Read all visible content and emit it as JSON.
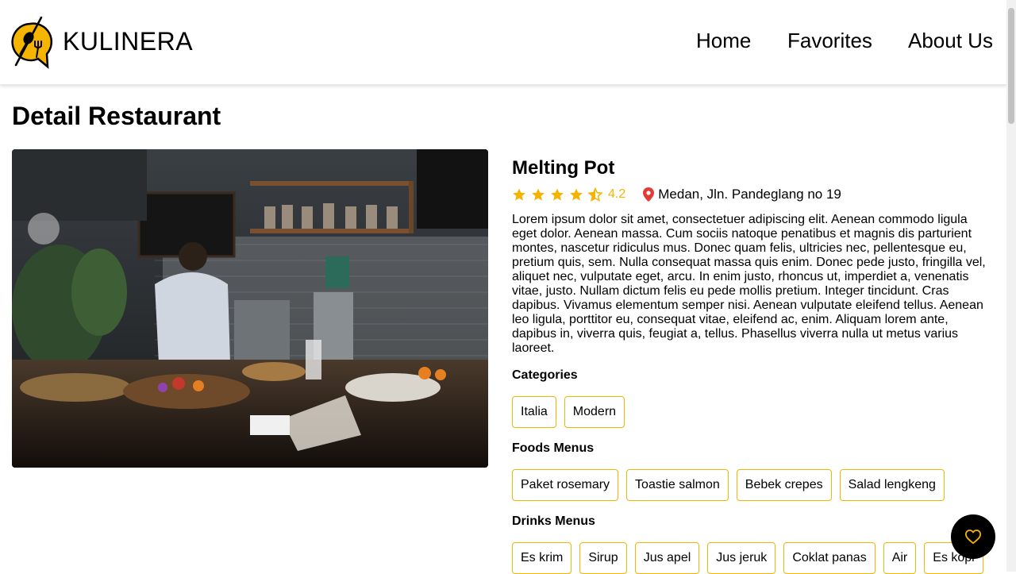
{
  "header": {
    "brand": "KULINERA",
    "nav": {
      "home": "Home",
      "favorites": "Favorites",
      "about": "About Us"
    }
  },
  "page": {
    "title": "Detail Restaurant"
  },
  "restaurant": {
    "name": "Melting Pot",
    "rating": 4.2,
    "rating_text": "4.2",
    "location": "Medan, Jln. Pandeglang no 19",
    "description": "Lorem ipsum dolor sit amet, consectetuer adipiscing elit. Aenean commodo ligula eget dolor. Aenean massa. Cum sociis natoque penatibus et magnis dis parturient montes, nascetur ridiculus mus. Donec quam felis, ultricies nec, pellentesque eu, pretium quis, sem. Nulla consequat massa quis enim. Donec pede justo, fringilla vel, aliquet nec, vulputate eget, arcu. In enim justo, rhoncus ut, imperdiet a, venenatis vitae, justo. Nullam dictum felis eu pede mollis pretium. Integer tincidunt. Cras dapibus. Vivamus elementum semper nisi. Aenean vulputate eleifend tellus. Aenean leo ligula, porttitor eu, consequat vitae, eleifend ac, enim. Aliquam lorem ante, dapibus in, viverra quis, feugiat a, tellus. Phasellus viverra nulla ut metus varius laoreet.",
    "sections": {
      "categories_title": "Categories",
      "categories": [
        "Italia",
        "Modern"
      ],
      "foods_title": "Foods Menus",
      "foods": [
        "Paket rosemary",
        "Toastie salmon",
        "Bebek crepes",
        "Salad lengkeng"
      ],
      "drinks_title": "Drinks Menus",
      "drinks": [
        "Es krim",
        "Sirup",
        "Jus apel",
        "Jus jeruk",
        "Coklat panas",
        "Air",
        "Es kopi"
      ]
    }
  },
  "icons": {
    "logo": "spoon-fork-icon",
    "star": "star-icon",
    "half_star": "star-half-icon",
    "location": "map-pin-icon",
    "favorite": "heart-icon"
  },
  "colors": {
    "accent": "#f4b400",
    "pin": "#e53935",
    "fab_bg": "#000000"
  }
}
